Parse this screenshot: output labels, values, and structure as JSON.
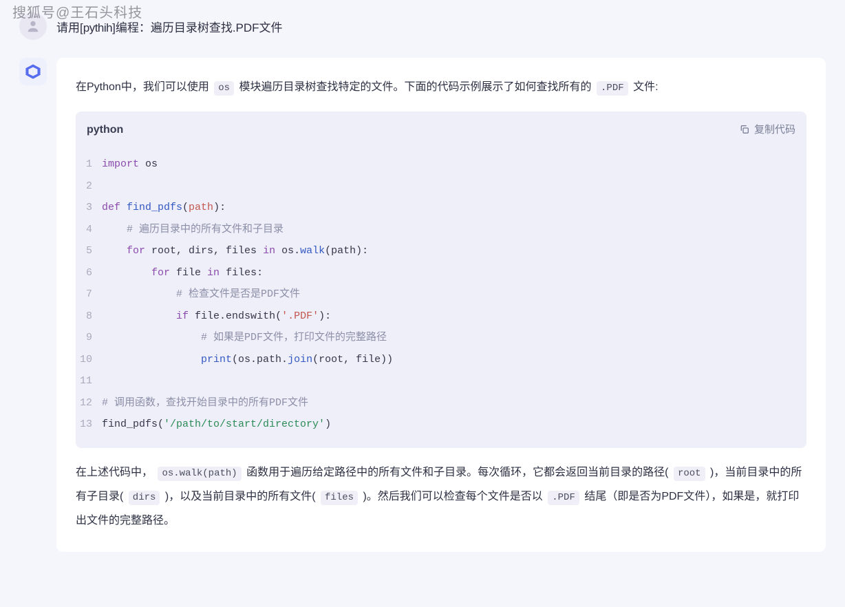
{
  "watermark": "搜狐号@王石头科技",
  "user": {
    "prefix": "请用[",
    "typo": "pythih",
    "suffix": "]编程：遍历目录树查找.PDF文件"
  },
  "assistant": {
    "intro_1": "在Python中，我们可以使用",
    "intro_code": "os",
    "intro_2": "模块遍历目录树查找特定的文件。下面的代码示例展示了如何查找所有的",
    "intro_code2": ".PDF",
    "intro_3": "文件:",
    "code": {
      "language": "python",
      "copy_label": "复制代码",
      "lines": {
        "l1_import": "import",
        "l1_os": " os",
        "l3_def": "def ",
        "l3_fn": "find_pdfs",
        "l3_p1": "(",
        "l3_param": "path",
        "l3_p2": "):",
        "l4_indent": "    ",
        "l4_comment": "# 遍历目录中的所有文件和子目录",
        "l5_indent": "    ",
        "l5_for": "for",
        "l5_vars": " root, dirs, files ",
        "l5_in": "in",
        "l5_call": " os.",
        "l5_walk": "walk",
        "l5_args": "(path):",
        "l6_indent": "        ",
        "l6_for": "for",
        "l6_file": " file ",
        "l6_in": "in",
        "l6_files": " files:",
        "l7_indent": "            ",
        "l7_comment": "# 检查文件是否是PDF文件",
        "l8_indent": "            ",
        "l8_if": "if",
        "l8_call": " file.endswith(",
        "l8_str": "'.PDF'",
        "l8_end": "):",
        "l9_indent": "                ",
        "l9_comment": "# 如果是PDF文件，打印文件的完整路径",
        "l10_indent": "                ",
        "l10_print": "print",
        "l10_p1": "(os.path.",
        "l10_join": "join",
        "l10_args": "(root, file))",
        "l12_comment": "# 调用函数，查找开始目录中的所有PDF文件",
        "l13_fn": "find_pdfs(",
        "l13_str": "'/path/to/start/directory'",
        "l13_end": ")"
      },
      "line_numbers": [
        "1",
        "2",
        "3",
        "4",
        "5",
        "6",
        "7",
        "8",
        "9",
        "10",
        "11",
        "12",
        "13"
      ]
    },
    "explain_1": "在上述代码中，",
    "explain_c1": "os.walk(path)",
    "explain_2": "函数用于遍历给定路径中的所有文件和子目录。每次循环，它都会返回当前目录的路径(",
    "explain_c2": "root",
    "explain_3": ")，当前目录中的所有子目录(",
    "explain_c3": "dirs",
    "explain_4": ")，以及当前目录中的所有文件(",
    "explain_c4": "files",
    "explain_5": ")。然后我们可以检查每个文件是否以",
    "explain_c5": ".PDF",
    "explain_6": "结尾（即是否为PDF文件），如果是，就打印出文件的完整路径。"
  }
}
